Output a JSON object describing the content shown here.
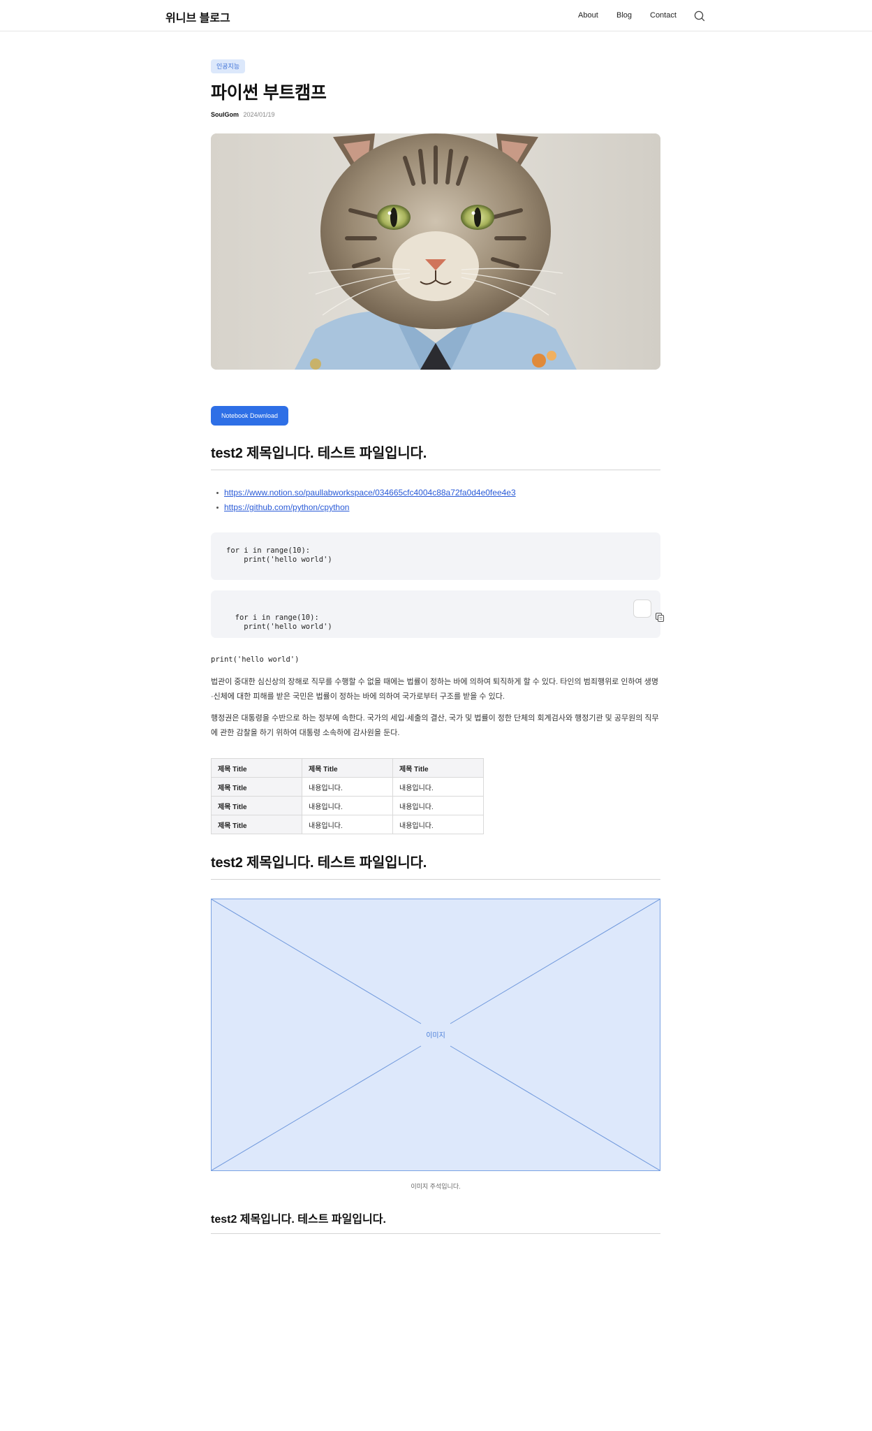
{
  "header": {
    "brand": "위니브 블로그",
    "nav": [
      "About",
      "Blog",
      "Contact"
    ],
    "search_icon": "search-icon"
  },
  "post": {
    "tag": "인공지능",
    "title": "파이썬 부트캠프",
    "author": "SoulGom",
    "date": "2024/01/19",
    "hero_alt": "embroidered-tabby-cat-in-denim-jacket"
  },
  "download_button": "Notebook Download",
  "section1": {
    "heading": "test2 제목입니다. 테스트 파일입니다.",
    "links": [
      "https://www.notion.so/paullabworkspace/034665cfc4004c88a72fa0d4e0fee4e3",
      "https://github.com/python/cpython"
    ],
    "code_blocks": [
      "for i in range(10):\n    print('hello world')",
      "for i in range(10):\n    print('hello world')"
    ],
    "copy_icon": "copy-icon",
    "inline_code": "print('hello world')",
    "paragraphs": [
      "법관이 중대한 심신상의 장해로 직무를 수행할 수 없을 때에는 법률이 정하는 바에 의하여 퇴직하게 할 수 있다. 타인의 범죄행위로 인하여 생명·신체에 대한 피해를 받은 국민은 법률이 정하는 바에 의하여 국가로부터 구조를 받을 수 있다.",
      "행정권은 대통령을 수반으로 하는 정부에 속한다. 국가의 세입·세출의 결산, 국가 및 법률이 정한 단체의 회계검사와 행정기관 및 공무원의 직무에 관한 감찰을 하기 위하여 대통령 소속하에 감사원을 둔다."
    ],
    "table": {
      "header": [
        "제목 Title",
        "제목 Title",
        "제목 Title"
      ],
      "rows": [
        [
          "제목 Title",
          "내용입니다.",
          "내용입니다."
        ],
        [
          "제목 Title",
          "내용입니다.",
          "내용입니다."
        ],
        [
          "제목 Title",
          "내용입니다.",
          "내용입니다."
        ]
      ]
    }
  },
  "section2": {
    "heading": "test2 제목입니다. 테스트 파일입니다.",
    "image_label": "이미지",
    "caption": "이미지 주석입니다.",
    "accent": "#4a7ed8",
    "fill": "#dde8fb"
  },
  "section3": {
    "heading": "test2 제목입니다. 테스트 파일입니다."
  },
  "colors": {
    "primary": "#2e6fe6",
    "tag_bg": "#dce8fb",
    "link": "#2a5bd7",
    "code_bg": "#f3f4f7"
  }
}
